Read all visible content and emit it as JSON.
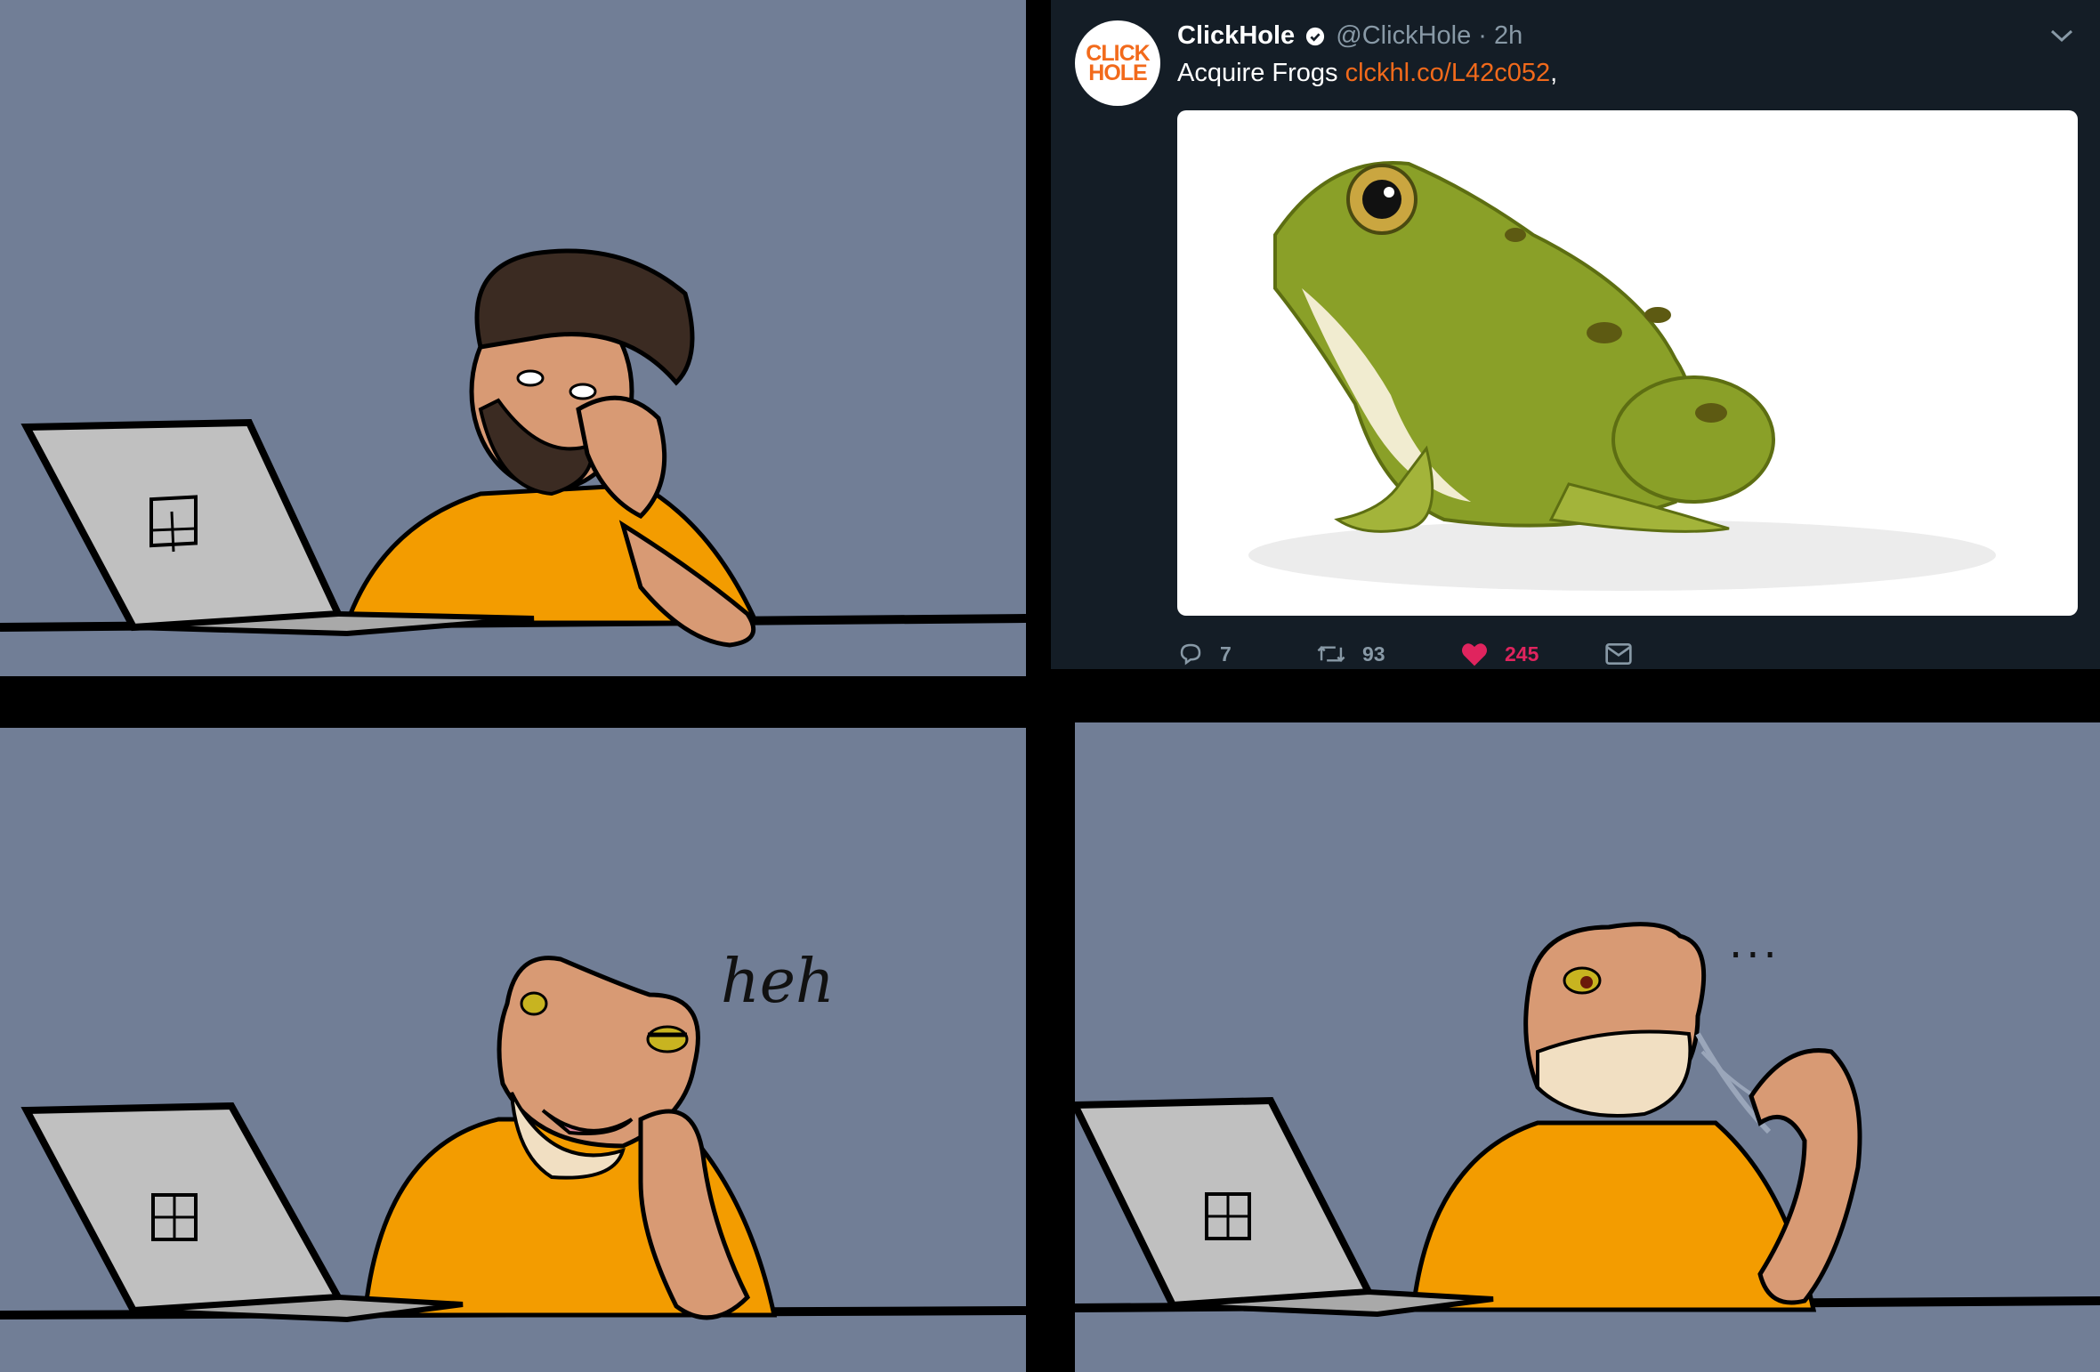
{
  "tweet": {
    "avatar_line1": "CLICK",
    "avatar_line2": "HOLE",
    "name": "ClickHole",
    "handle": "@ClickHole",
    "time": "· 2h",
    "text": "Acquire Frogs ",
    "link": "clckhl.co/L42c052",
    "text_suffix": ",",
    "replies": "7",
    "retweets": "93",
    "likes": "245",
    "accent_color": "#f26a1b",
    "like_color": "#e0245e",
    "background_color": "#141d26"
  },
  "panel3": {
    "speech": "heh"
  },
  "panel4": {
    "speech": "..."
  },
  "colors": {
    "panel_bg": "#717e96",
    "shirt": "#f39c00",
    "skin": "#d89a74",
    "laptop": "#c0c0c0"
  },
  "icons": [
    "reply-icon",
    "retweet-icon",
    "heart-icon",
    "message-icon",
    "chevron-down-icon",
    "verified-icon"
  ]
}
